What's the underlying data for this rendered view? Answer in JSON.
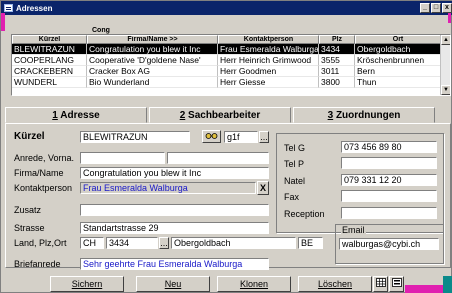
{
  "window": {
    "title": "Adressen",
    "min": "_",
    "max": "□",
    "close": "x"
  },
  "grid": {
    "group_label": "Cong",
    "headers": [
      "Kürzel",
      "Firma/Name >>",
      "Kontaktperson",
      "Plz",
      "Ort"
    ],
    "rows": [
      [
        "BLEWITRAZUN",
        "Congratulation you blew it Inc",
        "Frau Esmeralda Walburga",
        "3434",
        "Obergoldbach"
      ],
      [
        "COOPERLANG",
        "Cooperative 'D'goldene Nase'",
        "Herr Heinrich Grimwood",
        "3555",
        "Kröschenbrunnen"
      ],
      [
        "CRACKEBERN",
        "Cracker Box AG",
        "Herr Goodmen",
        "3011",
        "Bern"
      ],
      [
        "WUNDERL",
        "Bio Wunderland",
        "Herr Giesse",
        "3800",
        "Thun"
      ]
    ]
  },
  "tabs": [
    {
      "num": "1",
      "label": "Adresse"
    },
    {
      "num": "2",
      "label": "Sachbearbeiter"
    },
    {
      "num": "3",
      "label": "Zuordnungen"
    }
  ],
  "form": {
    "kuerzel_label": "Kürzel",
    "kuerzel": "BLEWITRAZUN",
    "code": "g1f",
    "anrede_label": "Anrede, Vorna.",
    "firma_label": "Firma/Name",
    "firma": "Congratulation you blew it Inc",
    "kontakt_label": "Kontaktperson",
    "kontakt": "Frau Esmeralda Walburga",
    "zusatz_label": "Zusatz",
    "strasse_label": "Strasse",
    "strasse": "Standartstrasse 29",
    "land_label": "Land, Plz,Ort",
    "land": "CH",
    "plz": "3434",
    "ort": "Obergoldbach",
    "kanton": "BE",
    "briefanrede_label": "Briefanrede",
    "briefanrede": "Sehr geehrte Frau Esmeralda Walburga",
    "x_label": "X",
    "dots": "..."
  },
  "contact": {
    "telg_label": "Tel G",
    "telg": "073 456 89 80",
    "telp_label": "Tel P",
    "natel_label": "Natel",
    "natel": "079 331 12 20",
    "fax_label": "Fax",
    "reception_label": "Reception",
    "email_label": "Email",
    "email": "walburgas@cybi.ch"
  },
  "buttons": {
    "sichern": "Sichern",
    "neu": "Neu",
    "klonen": "Klonen",
    "loeschen": "Löschen"
  }
}
